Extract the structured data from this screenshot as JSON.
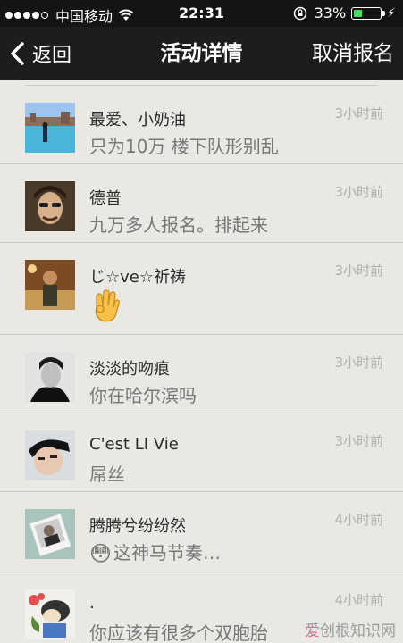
{
  "status_bar": {
    "carrier": "中国移动",
    "time": "22:31",
    "battery_percent": "33%",
    "battery_level": 0.33,
    "signal_dots_filled": 4,
    "signal_dots_total": 5
  },
  "nav": {
    "back_label": "返回",
    "title": "活动详情",
    "right_label": "取消报名"
  },
  "colors": {
    "nav_bg": "#1d1d1d",
    "list_bg": "#e9e8e3",
    "battery_fill": "#4cd964"
  },
  "comments": [
    {
      "name": "最爱、小奶油",
      "message": "只为10万 楼下队形别乱",
      "time": "3小时前",
      "avatar": "scenery-avatar"
    },
    {
      "name": "德普",
      "message": "九万多人报名。排起来",
      "time": "3小时前",
      "avatar": "portrait-avatar"
    },
    {
      "name": "じ☆ve☆祈祷",
      "message": "",
      "emoji_icon": "ok-hand-emoji",
      "time": "3小时前",
      "avatar": "person-avatar"
    },
    {
      "name": "淡淡的吻痕",
      "message": "你在哈尔滨吗",
      "time": "3小时前",
      "avatar": "bw-portrait-avatar"
    },
    {
      "name": "C'est LI Vie",
      "message": "屌丝",
      "time": "3小时前",
      "avatar": "selfie-avatar"
    },
    {
      "name": "腾腾兮纷纷然",
      "message": "这神马节奏…",
      "emoji": "😳",
      "time": "4小时前",
      "avatar": "photo-avatar"
    },
    {
      "name": ".",
      "message": "你应该有很多个双胞胎",
      "time": "4小时前",
      "avatar": "cartoon-avatar"
    }
  ],
  "watermark": {
    "prefix": "爱",
    "suffix": "创根知识网"
  }
}
